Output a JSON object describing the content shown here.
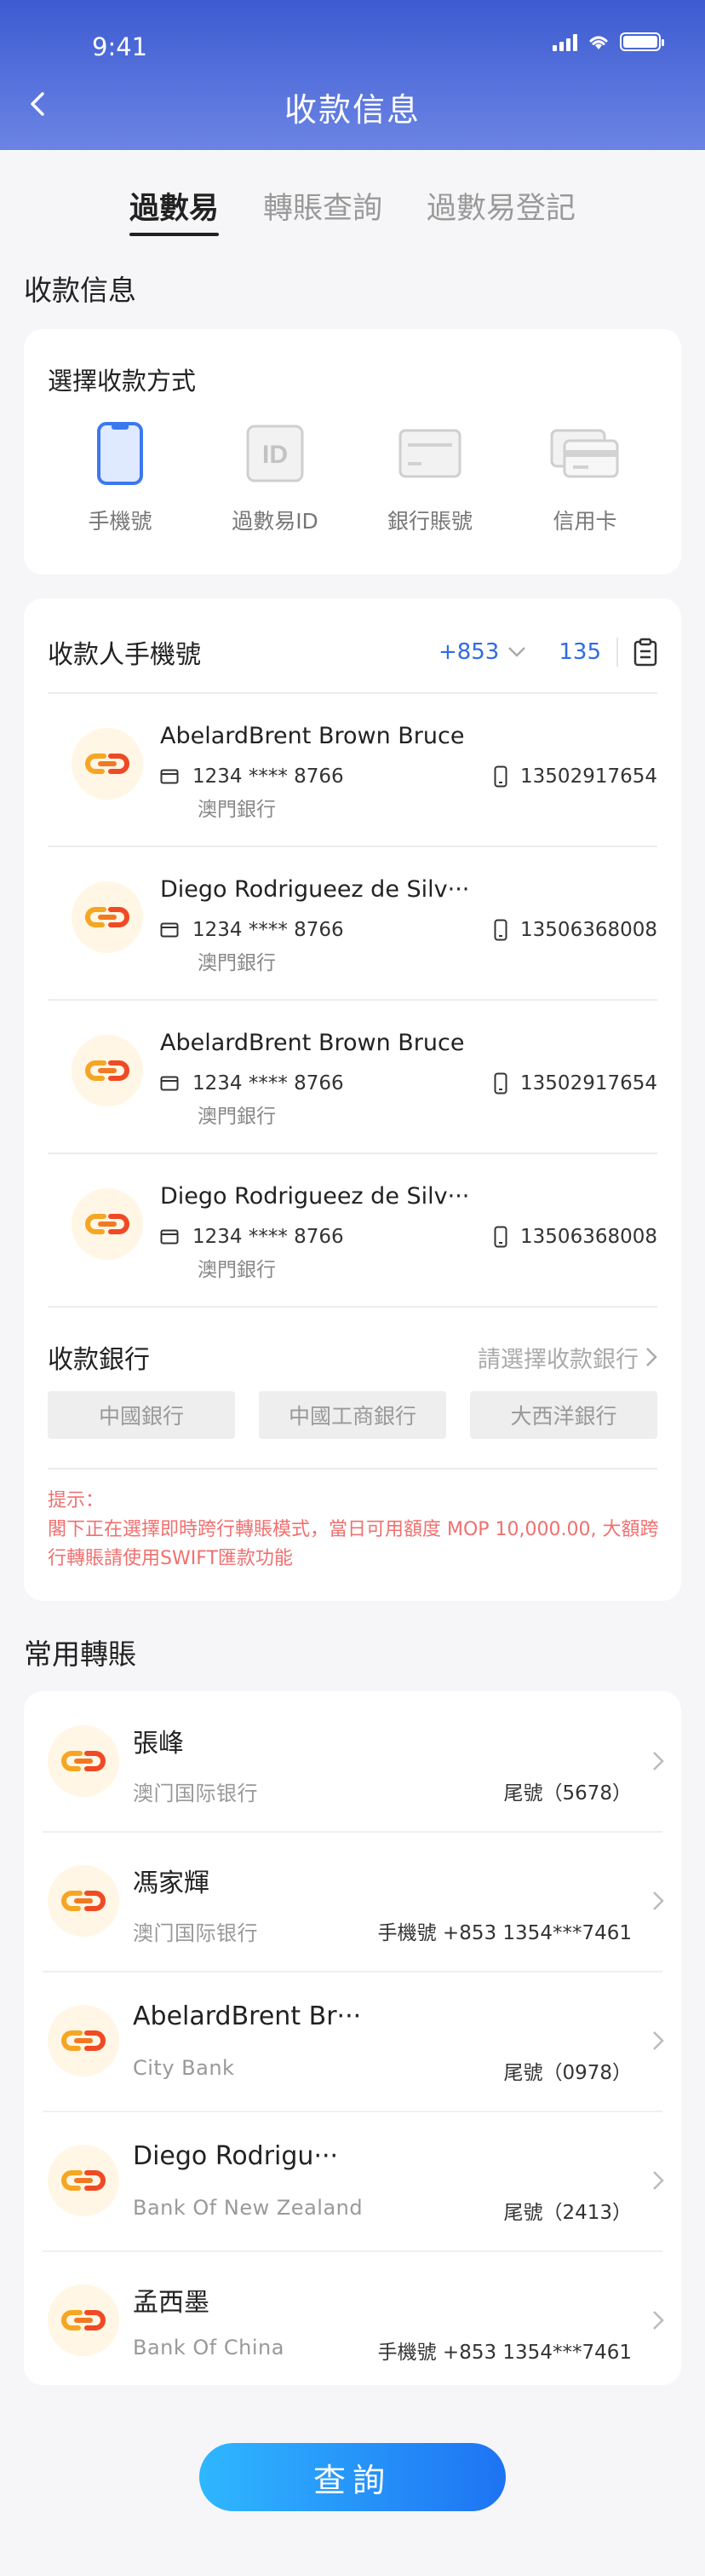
{
  "status": {
    "time": "9:41"
  },
  "header": {
    "title": "收款信息"
  },
  "tabs": [
    {
      "label": "過數易",
      "active": true
    },
    {
      "label": "轉賬查詢",
      "active": false
    },
    {
      "label": "過數易登記",
      "active": false
    }
  ],
  "section_receive": "收款信息",
  "method_card": {
    "title": "選擇收款方式",
    "methods": [
      {
        "label": "手機號",
        "icon": "phone-icon",
        "selected": true
      },
      {
        "label": "過數易ID",
        "icon": "id-icon",
        "selected": false
      },
      {
        "label": "銀行賬號",
        "icon": "bank-account-icon",
        "selected": false
      },
      {
        "label": "信用卡",
        "icon": "credit-card-icon",
        "selected": false
      }
    ]
  },
  "receiver_card": {
    "title": "收款人手機號",
    "area_code": "+853",
    "phone_prefix": "135",
    "contacts": [
      {
        "name": "AbelardBrent Brown Bruce",
        "card": "1234 **** 8766",
        "bank": "澳門銀行",
        "phone": "13502917654"
      },
      {
        "name": "Diego Rodrigueez de Silv···",
        "card": "1234 **** 8766",
        "bank": "澳門銀行",
        "phone": "13506368008"
      },
      {
        "name": "AbelardBrent Brown Bruce",
        "card": "1234 **** 8766",
        "bank": "澳門銀行",
        "phone": "13502917654"
      },
      {
        "name": "Diego Rodrigueez de Silv···",
        "card": "1234 **** 8766",
        "bank": "澳門銀行",
        "phone": "13506368008"
      }
    ],
    "bank_title": "收款銀行",
    "bank_placeholder": "請選擇收款銀行",
    "bank_chips": [
      "中國銀行",
      "中國工商銀行",
      "大西洋銀行"
    ],
    "hint_title": "提示：",
    "hint_text": "閣下正在選擇即時跨行轉賬模式，當日可用額度 MOP 10,000.00, 大額跨行轉賬請使用SWIFT匯款功能"
  },
  "section_frequent": "常用轉賬",
  "frequent": [
    {
      "name": "張峰",
      "bank": "澳门国际银行",
      "detail": "尾號（5678）"
    },
    {
      "name": "馮家輝",
      "bank": "澳门国际银行",
      "detail": "手機號 +853 1354***7461"
    },
    {
      "name": "AbelardBrent Br···",
      "bank": "City Bank",
      "detail": "尾號（0978）"
    },
    {
      "name": "Diego Rodrigu···",
      "bank": "Bank Of  New Zealand",
      "detail": "尾號（2413）"
    },
    {
      "name": "孟西墨",
      "bank": "Bank Of China",
      "detail": "手機號 +853 1354***7461"
    }
  ],
  "query_button": "查詢",
  "colors": {
    "header": "#3d5bd1",
    "accent": "#2f6be6",
    "hint": "#f07070",
    "logo": "#f5a623"
  }
}
